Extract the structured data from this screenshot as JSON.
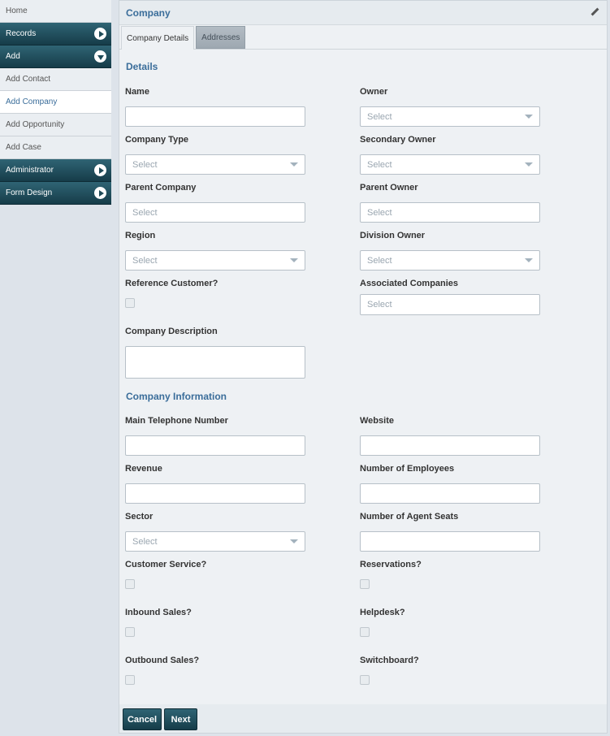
{
  "sidebar": {
    "items": [
      {
        "label": "Home"
      },
      {
        "label": "Records"
      },
      {
        "label": "Add"
      },
      {
        "label": "Add Contact"
      },
      {
        "label": "Add Company"
      },
      {
        "label": "Add Opportunity"
      },
      {
        "label": "Add Case"
      },
      {
        "label": "Administrator"
      },
      {
        "label": "Form Design"
      }
    ]
  },
  "header": {
    "title": "Company"
  },
  "tabs": [
    {
      "label": "Company Details"
    },
    {
      "label": "Addresses"
    }
  ],
  "sections": {
    "details": "Details",
    "company_info": "Company Information"
  },
  "fields": {
    "name": {
      "label": "Name",
      "value": ""
    },
    "owner": {
      "label": "Owner",
      "placeholder": "Select"
    },
    "company_type": {
      "label": "Company Type",
      "placeholder": "Select"
    },
    "secondary_owner": {
      "label": "Secondary Owner",
      "placeholder": "Select"
    },
    "parent_company": {
      "label": "Parent Company",
      "placeholder": "Select"
    },
    "parent_owner": {
      "label": "Parent Owner",
      "placeholder": "Select"
    },
    "region": {
      "label": "Region",
      "placeholder": "Select"
    },
    "division_owner": {
      "label": "Division Owner",
      "placeholder": "Select"
    },
    "reference_customer": {
      "label": "Reference Customer?"
    },
    "associated_companies": {
      "label": "Associated Companies",
      "placeholder": "Select"
    },
    "company_description": {
      "label": "Company Description"
    },
    "main_phone": {
      "label": "Main Telephone Number"
    },
    "website": {
      "label": "Website"
    },
    "revenue": {
      "label": "Revenue"
    },
    "num_employees": {
      "label": "Number of Employees"
    },
    "sector": {
      "label": "Sector",
      "placeholder": "Select"
    },
    "agent_seats": {
      "label": "Number of Agent Seats"
    },
    "customer_service": {
      "label": "Customer Service?"
    },
    "reservations": {
      "label": "Reservations?"
    },
    "inbound_sales": {
      "label": "Inbound Sales?"
    },
    "helpdesk": {
      "label": "Helpdesk?"
    },
    "outbound_sales": {
      "label": "Outbound Sales?"
    },
    "switchboard": {
      "label": "Switchboard?"
    }
  },
  "buttons": {
    "cancel": "Cancel",
    "next": "Next"
  },
  "colors": {
    "accent": "#3a6d9a",
    "nav_dark": "#1f4a57"
  }
}
